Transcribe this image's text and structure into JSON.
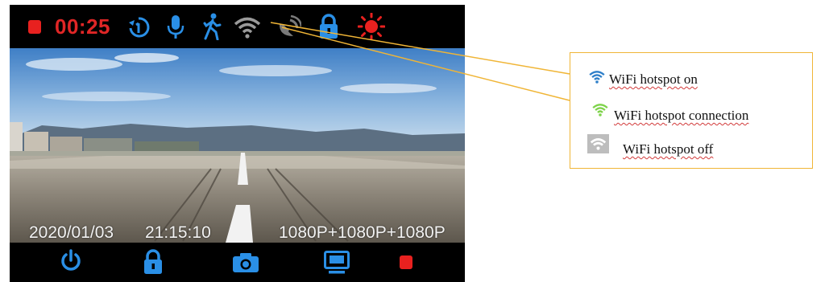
{
  "top_bar": {
    "record_time": "00:25",
    "icons": [
      "stop-recording-icon",
      "timer-icon",
      "microphone-icon",
      "motion-detection-icon",
      "wifi-icon",
      "gps-icon",
      "lock-icon",
      "brightness-icon"
    ]
  },
  "camera_overlay": {
    "date": "2020/01/03",
    "time": "21:15:10",
    "resolution": "1080P+1080P+1080P"
  },
  "bottom_bar": {
    "buttons": [
      "power-icon",
      "lock-icon",
      "camera-icon",
      "screen-icon",
      "record-icon"
    ]
  },
  "legend": {
    "items": [
      {
        "label": "WiFi hotspot on",
        "icon_color": "#2e7fc9"
      },
      {
        "label": "WiFi hotspot connection",
        "icon_color": "#7ed34a"
      },
      {
        "label": "WiFi hotspot off",
        "icon_color": "#bdbdbd"
      }
    ]
  },
  "colors": {
    "accent_blue": "#2196f3",
    "record_red": "#e8211f",
    "callout_line": "#f0b536"
  }
}
